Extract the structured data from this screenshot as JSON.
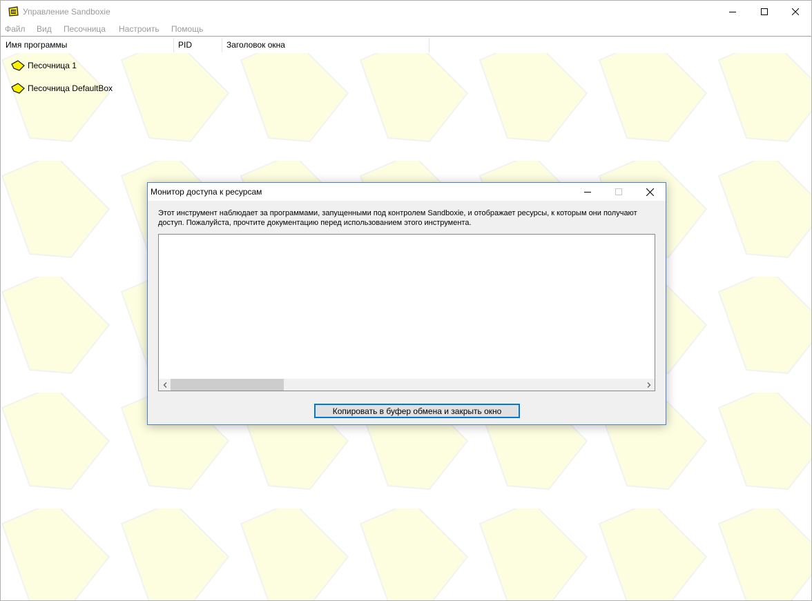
{
  "main_window": {
    "title": "Управление Sandboxie",
    "menu": [
      "Файл",
      "Вид",
      "Песочница",
      "Настроить",
      "Помощь"
    ],
    "columns": [
      "Имя программы",
      "PID",
      "Заголовок окна"
    ],
    "sandboxes": [
      {
        "label": "Песочница 1",
        "icon": "sandbox-icon"
      },
      {
        "label": "Песочница DefaultBox",
        "icon": "sandbox-icon"
      }
    ]
  },
  "dialog": {
    "title": "Монитор доступа к ресурсам",
    "description": "Этот инструмент наблюдает за программами, запущенными под контролем Sandboxie, и отображает ресурсы, к которым они получают доступ.  Пожалуйста, прочтите документацию перед использованием этого инструмента.",
    "copy_button_label": "Копировать в буфер обмена и закрыть окно"
  },
  "colors": {
    "pattern_fill": "#fdfde0",
    "pattern_stroke": "#f4f4f4",
    "dialog_border": "#4a83c5",
    "button_focus": "#0078d7",
    "disabled_text": "#9a9a9a"
  }
}
